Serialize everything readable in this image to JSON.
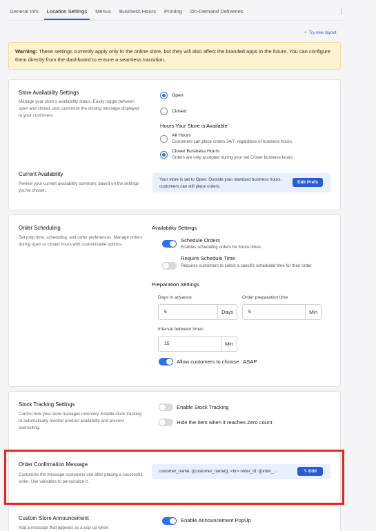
{
  "tabs": {
    "items": [
      "General Info",
      "Location Settings",
      "Menus",
      "Business Hours",
      "Printing",
      "On-Demand Deliveries"
    ],
    "more": "⋮"
  },
  "try_layout": {
    "icon": "+",
    "label": "Try new layout"
  },
  "warning": {
    "lead": "Warning:",
    "text": " These settings currently apply only to the online store, but they will also affect the branded apps in the future. You can configure them directly from the dashboard to ensure a seamless transition."
  },
  "store_availability": {
    "title": "Store Availability Settings",
    "desc": "Manage your store's availability status. Easily toggle between open and closed, and customize the closing message displayed to your customers.",
    "status_options": [
      "Open",
      "Closed"
    ],
    "status_selected": "Open",
    "hours_heading": "Hours Your Store is Available",
    "hours_options": [
      {
        "label": "All Hours",
        "desc": "Customers can place orders 24/7, regardless of business hours."
      },
      {
        "label": "Clover Business Hours",
        "desc": "Orders are only accepted during your set Clover business hours"
      }
    ],
    "hours_selected": "Clover Business Hours"
  },
  "current_availability": {
    "title": "Current Availability",
    "desc": "Review your current availability summary, based on the settings you've chosen.",
    "summary": "Your store is set to Open. Outside your standard business hours, customers can still place orders.",
    "button": "Edit Prefs"
  },
  "order_scheduling": {
    "title": "Order Scheduling",
    "desc": "Set prep time, scheduling, and order preferences. Manage orders during open or closed hours with customizable options.",
    "availability_heading": "Availability Settings",
    "schedule_orders": {
      "label": "Schedule Orders",
      "desc": "Enables scheduling orders for future times.",
      "enabled": true
    },
    "require_time": {
      "label": "Require Schedule Time",
      "desc": "Requires customers to select a specific scheduled time for their order.",
      "enabled": false
    },
    "prep_heading": "Preparation Settings",
    "days_in_advance": {
      "label": "Days in advance",
      "value": "5",
      "unit": "Days"
    },
    "prep_time": {
      "label": "Order preparation time",
      "value": "5",
      "unit": "Min"
    },
    "interval": {
      "label": "Interval between times",
      "value": "15",
      "unit": "Min"
    },
    "asap": {
      "label": "Allow customers to choose : ASAP",
      "enabled": true
    }
  },
  "stock_tracking": {
    "title": "Stock Tracking Settings",
    "desc": "Control how your store manages inventory. Enable stock tracking to automatically monitor product availability and prevent overselling.",
    "enable": {
      "label": "Enable Stock Tracking",
      "enabled": false
    },
    "hide_zero": {
      "label": "Hide the item when it reaches Zero count",
      "enabled": false
    }
  },
  "order_confirmation": {
    "title": "Order Confirmation Message",
    "desc": "Customize the message customers see after placing a successful order. Use variables to personalize it.",
    "preview": "customer_name: {{customer_name}}, <br> order_id: {{order_...",
    "button": "Edit"
  },
  "announcement": {
    "title": "Custom Store Announcement",
    "desc": "Add a message that appears as a pop-up when",
    "toggle_label": "Enable Announcement PopUp",
    "enabled": true
  },
  "colors": {
    "accent": "#2f6fe8",
    "button": "#2a5bd6",
    "highlight": "#e8251d",
    "warning_bg": "#fdf3d0"
  }
}
